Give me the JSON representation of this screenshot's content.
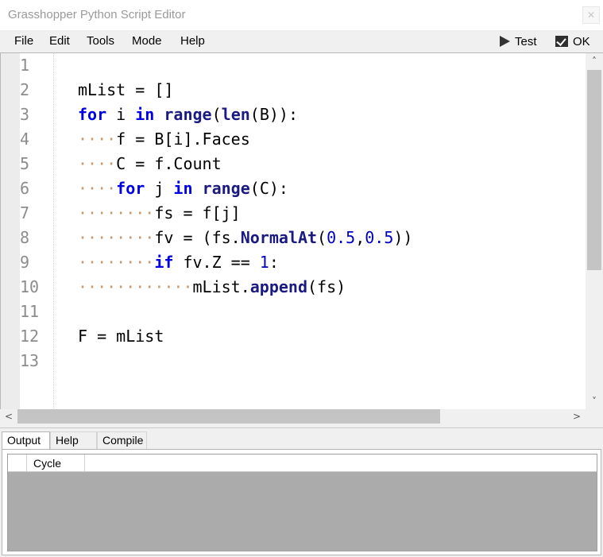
{
  "window": {
    "title": "Grasshopper Python Script Editor",
    "close_label": "✕"
  },
  "menu": {
    "items": [
      "File",
      "Edit",
      "Tools",
      "Mode",
      "Help"
    ]
  },
  "toolbar": {
    "test_label": "Test",
    "ok_label": "OK"
  },
  "editor": {
    "line_numbers": [
      "1",
      "2",
      "3",
      "4",
      "5",
      "6",
      "7",
      "8",
      "9",
      "10",
      "11",
      "12",
      "13"
    ],
    "lines": [
      [],
      [
        [
          "mList = []",
          ""
        ]
      ],
      [
        [
          "for",
          "kw"
        ],
        [
          " i ",
          ""
        ],
        [
          "in",
          "kw"
        ],
        [
          " ",
          ""
        ],
        [
          "range",
          "fn"
        ],
        [
          "(",
          ""
        ],
        [
          "len",
          "fn"
        ],
        [
          "(B)):",
          ""
        ]
      ],
      [
        [
          "····",
          "ind"
        ],
        [
          "f = B[i].Faces",
          ""
        ]
      ],
      [
        [
          "····",
          "ind"
        ],
        [
          "C = f.Count",
          ""
        ]
      ],
      [
        [
          "····",
          "ind"
        ],
        [
          "for",
          "kw"
        ],
        [
          " j ",
          ""
        ],
        [
          "in",
          "kw"
        ],
        [
          " ",
          ""
        ],
        [
          "range",
          "fn"
        ],
        [
          "(C):",
          ""
        ]
      ],
      [
        [
          "········",
          "ind"
        ],
        [
          "fs = f[j]",
          ""
        ]
      ],
      [
        [
          "········",
          "ind"
        ],
        [
          "fv = (fs.",
          ""
        ],
        [
          "NormalAt",
          "fn"
        ],
        [
          "(",
          ""
        ],
        [
          "0.5",
          "num"
        ],
        [
          ",",
          ""
        ],
        [
          "0.5",
          "num"
        ],
        [
          "))",
          ""
        ]
      ],
      [
        [
          "········",
          "ind"
        ],
        [
          "if",
          "kw"
        ],
        [
          " fv.Z == ",
          ""
        ],
        [
          "1",
          "num"
        ],
        [
          ":",
          ""
        ]
      ],
      [
        [
          "············",
          "ind"
        ],
        [
          "mList.",
          ""
        ],
        [
          "append",
          "fn"
        ],
        [
          "(fs)",
          ""
        ]
      ],
      [],
      [
        [
          "F = mList",
          ""
        ]
      ],
      []
    ]
  },
  "scroll": {
    "up": "˄",
    "down": "˅",
    "left": "<",
    "right": ">"
  },
  "bottom": {
    "tabs": [
      "Output",
      "Help",
      "Compile"
    ],
    "active_tab": "Output",
    "columns": [
      "Cycle"
    ]
  },
  "colors": {
    "keyword": "#0000e6",
    "function": "#1a1a80",
    "number": "#0000c0",
    "indent_marker": "#c89870"
  }
}
